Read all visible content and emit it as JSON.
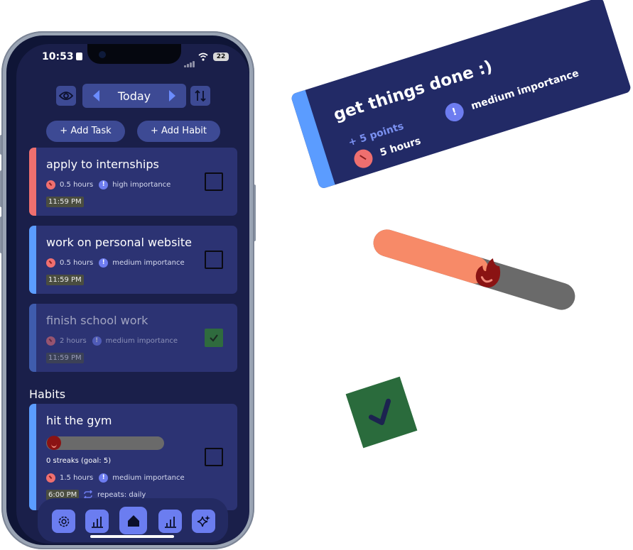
{
  "status": {
    "time": "10:53",
    "battery": "22"
  },
  "header": {
    "date_label": "Today"
  },
  "actions": {
    "add_task": "+ Add Task",
    "add_habit": "+ Add Habit"
  },
  "tasks": [
    {
      "title": "apply to internships",
      "hours": "0.5 hours",
      "importance": "high importance",
      "due": "11:59 PM",
      "color": "#ef6f6f",
      "done": false
    },
    {
      "title": "work on personal website",
      "hours": "0.5 hours",
      "importance": "medium importance",
      "due": "11:59 PM",
      "color": "#5b9cff",
      "done": false
    },
    {
      "title": "finish school work",
      "hours": "2 hours",
      "importance": "medium importance",
      "due": "11:59 PM",
      "color": "#5b9cff",
      "done": true
    }
  ],
  "habits_section": {
    "title": "Habits"
  },
  "habits": [
    {
      "title": "hit the gym",
      "streak_text": "0 streaks (goal: 5)",
      "hours": "1.5 hours",
      "importance": "medium importance",
      "time": "6:00 PM",
      "repeats": "repeats: daily",
      "progress": 0.0
    }
  ],
  "nav": {
    "items": [
      {
        "icon": "gear-icon"
      },
      {
        "icon": "bar-chart-icon"
      },
      {
        "icon": "home-icon",
        "active": true
      },
      {
        "icon": "stats-icon"
      },
      {
        "icon": "sparkle-icon"
      }
    ]
  },
  "float_card": {
    "title": "get things done :)",
    "points": "+ 5 points",
    "hours": "5 hours",
    "importance": "medium importance"
  },
  "float_progress": {
    "progress": 0.57
  },
  "colors": {
    "accent": "#5b9cff",
    "card": "#2c3373",
    "background": "#1a1f4a",
    "fill": "#f78a68",
    "high": "#ef6f6f",
    "medium": "#6d7cf0",
    "done": "#2f6b3e"
  }
}
